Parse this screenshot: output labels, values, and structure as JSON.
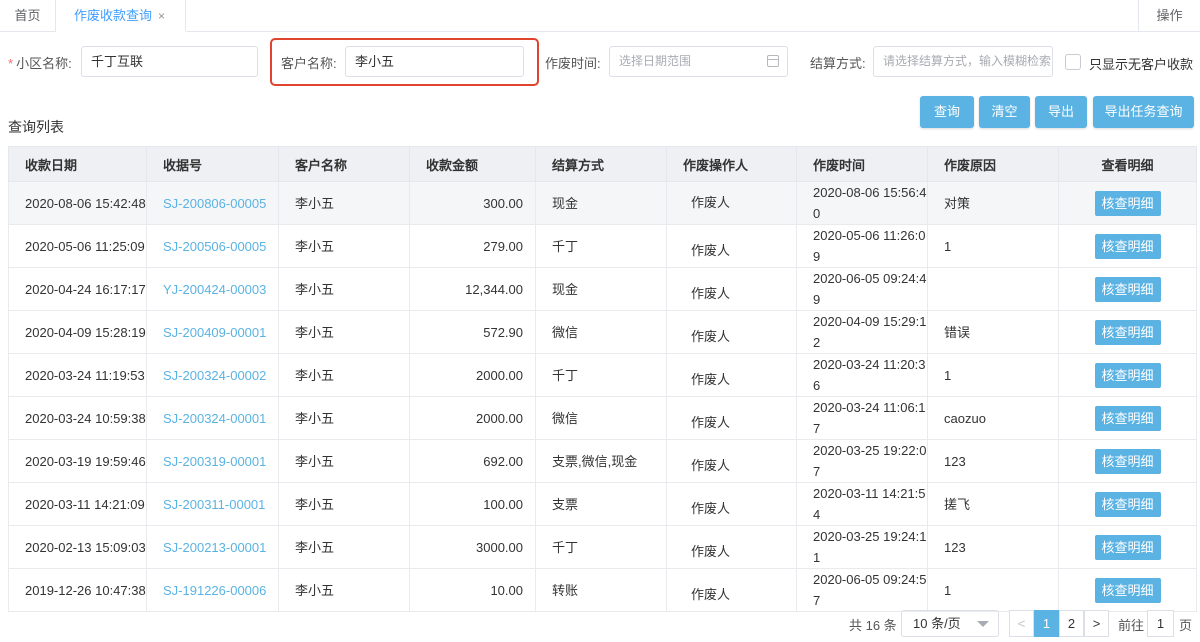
{
  "tabs": {
    "home": "首页",
    "active": "作废收款查询",
    "close": "×",
    "ops": "操作"
  },
  "filters": {
    "community_label": "小区名称:",
    "community_value": "千丁互联",
    "customer_label": "客户名称:",
    "customer_value": "李小五",
    "void_time_label": "作废时间:",
    "void_time_placeholder": "选择日期范围",
    "settle_label": "结算方式:",
    "settle_placeholder": "请选择结算方式，输入模糊检索",
    "only_no_customer_label": "只显示无客户收款"
  },
  "list_title": "查询列表",
  "buttons": {
    "query": "查询",
    "clear": "清空",
    "export": "导出",
    "export_task": "导出任务查询"
  },
  "table": {
    "headers": [
      "收款日期",
      "收据号",
      "客户名称",
      "收款金额",
      "结算方式",
      "作废操作人",
      "作废时间",
      "作废原因",
      "查看明细"
    ],
    "rows": [
      {
        "date": "2020-08-06 15:42:48",
        "receipt": "SJ-200806-00005",
        "customer": "李小五",
        "amount": "300.00",
        "method": "现金",
        "operator": "作废人",
        "void_time": "2020-08-06 15:56:40",
        "reason": "对策",
        "detail": "核查明细"
      },
      {
        "date": "2020-05-06 11:25:09",
        "receipt": "SJ-200506-00005",
        "customer": "李小五",
        "amount": "279.00",
        "method": "千丁",
        "operator": "作废人",
        "void_time": "2020-05-06 11:26:09",
        "reason": "1",
        "detail": "核查明细"
      },
      {
        "date": "2020-04-24 16:17:17",
        "receipt": "YJ-200424-00003",
        "customer": "李小五",
        "amount": "12,344.00",
        "method": "现金",
        "operator": "作废人",
        "void_time": "2020-06-05 09:24:49",
        "reason": "",
        "detail": "核查明细"
      },
      {
        "date": "2020-04-09 15:28:19",
        "receipt": "SJ-200409-00001",
        "customer": "李小五",
        "amount": "572.90",
        "method": "微信",
        "operator": "作废人",
        "void_time": "2020-04-09 15:29:12",
        "reason": "错误",
        "detail": "核查明细"
      },
      {
        "date": "2020-03-24 11:19:53",
        "receipt": "SJ-200324-00002",
        "customer": "李小五",
        "amount": "2000.00",
        "method": "千丁",
        "operator": "作废人",
        "void_time": "2020-03-24 11:20:36",
        "reason": "1",
        "detail": "核查明细"
      },
      {
        "date": "2020-03-24 10:59:38",
        "receipt": "SJ-200324-00001",
        "customer": "李小五",
        "amount": "2000.00",
        "method": "微信",
        "operator": "作废人",
        "void_time": "2020-03-24 11:06:17",
        "reason": "caozuo",
        "detail": "核查明细"
      },
      {
        "date": "2020-03-19 19:59:46",
        "receipt": "SJ-200319-00001",
        "customer": "李小五",
        "amount": "692.00",
        "method": "支票,微信,现金",
        "operator": "作废人",
        "void_time": "2020-03-25 19:22:07",
        "reason": "123",
        "detail": "核查明细"
      },
      {
        "date": "2020-03-11 14:21:09",
        "receipt": "SJ-200311-00001",
        "customer": "李小五",
        "amount": "100.00",
        "method": "支票",
        "operator": "作废人",
        "void_time": "2020-03-11 14:21:54",
        "reason": "搓飞",
        "detail": "核查明细"
      },
      {
        "date": "2020-02-13 15:09:03",
        "receipt": "SJ-200213-00001",
        "customer": "李小五",
        "amount": "3000.00",
        "method": "千丁",
        "operator": "作废人",
        "void_time": "2020-03-25 19:24:11",
        "reason": "123",
        "detail": "核查明细"
      },
      {
        "date": "2019-12-26 10:47:38",
        "receipt": "SJ-191226-00006",
        "customer": "李小五",
        "amount": "10.00",
        "method": "转账",
        "operator": "作废人",
        "void_time": "2020-06-05 09:24:57",
        "reason": "1",
        "detail": "核查明细"
      }
    ]
  },
  "pagination": {
    "total": "共 16 条",
    "page_size": "10 条/页",
    "prev": "<",
    "pages": [
      "1",
      "2"
    ],
    "next": ">",
    "goto_label": "前往",
    "goto_value": "1",
    "goto_unit": "页"
  }
}
